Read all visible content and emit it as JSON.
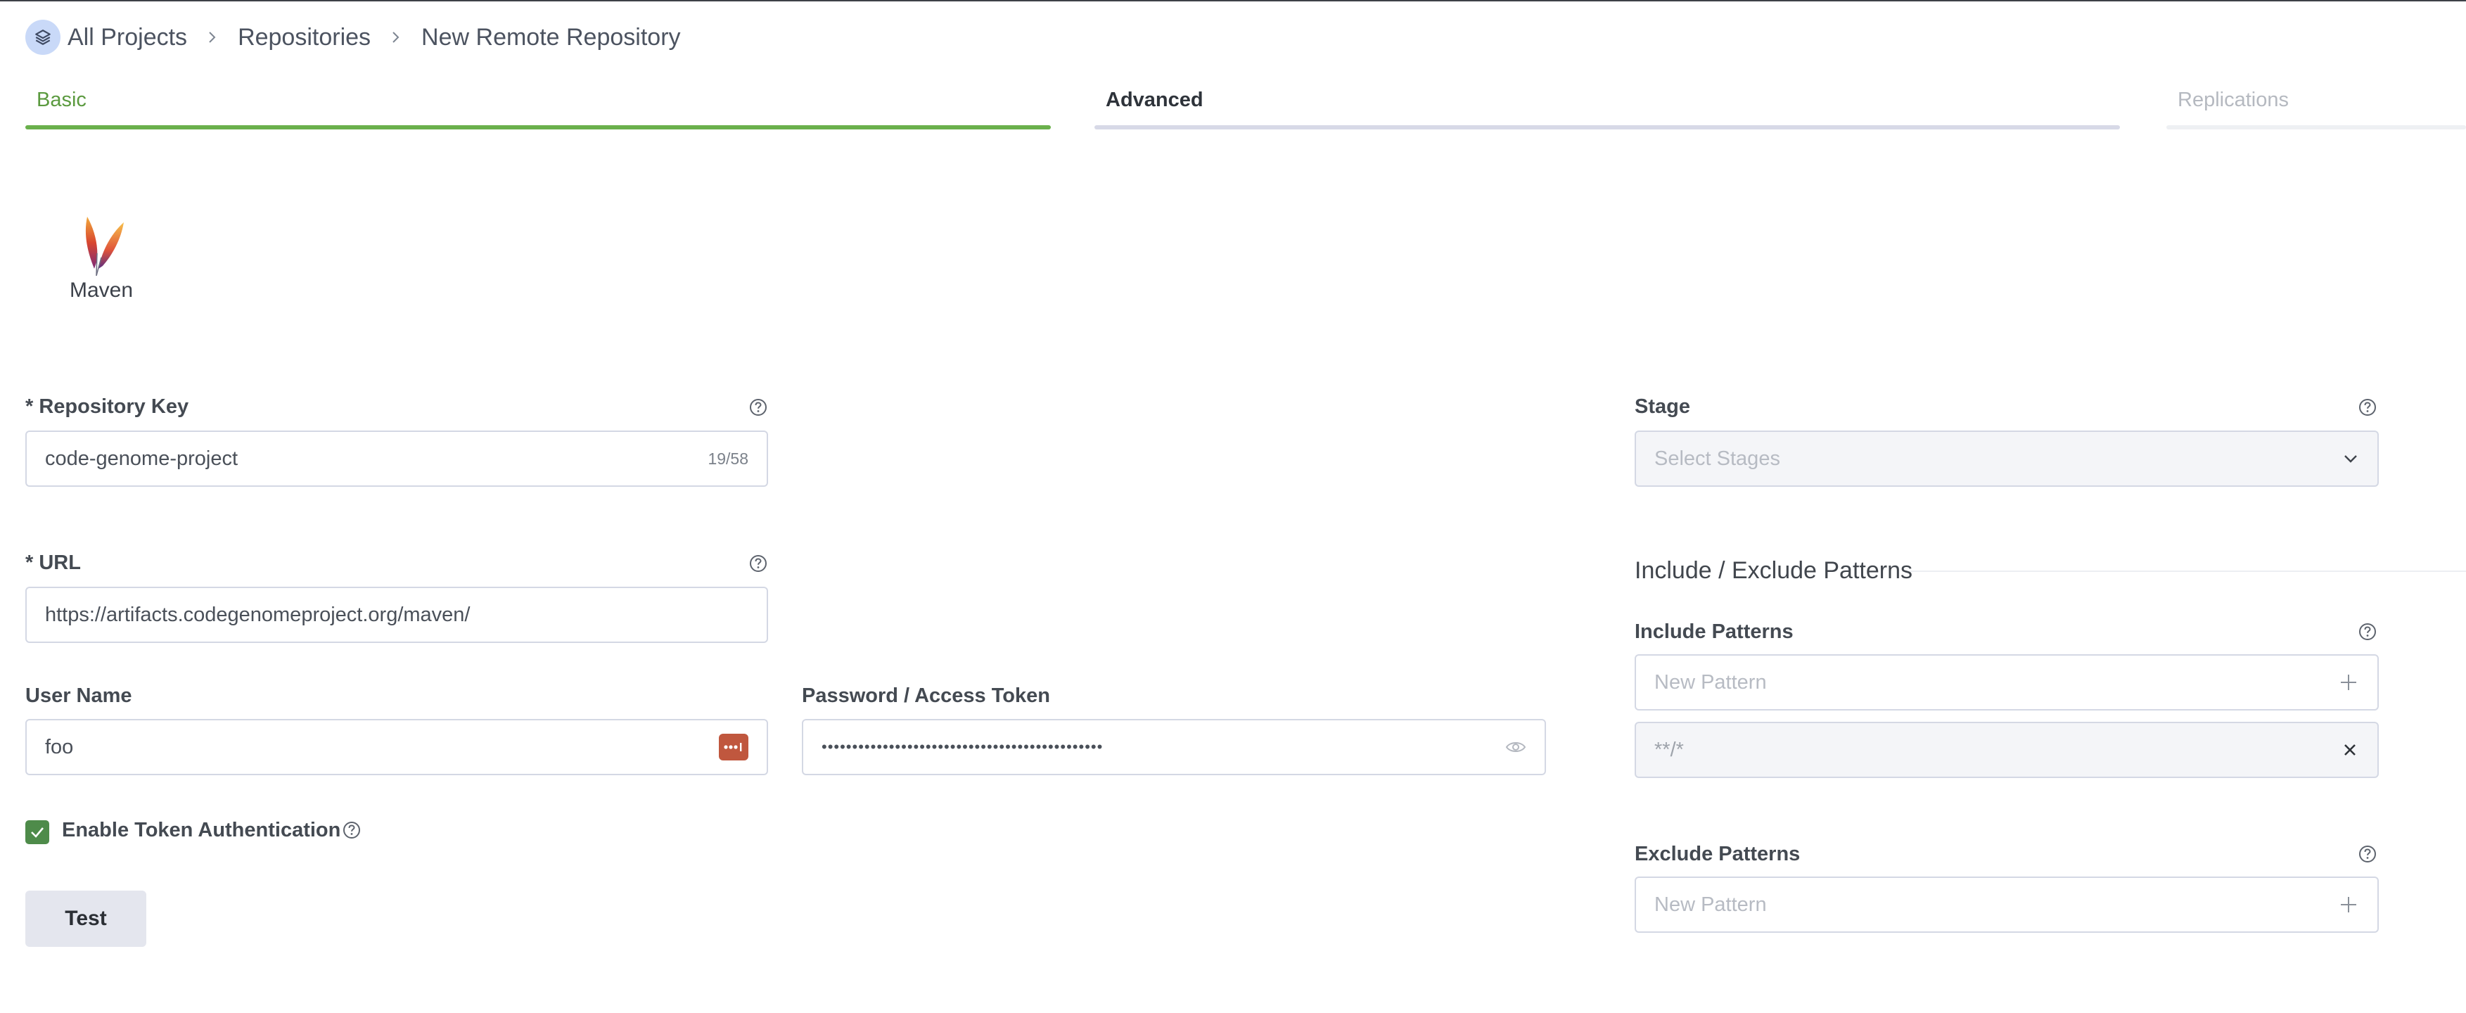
{
  "breadcrumb": {
    "items": [
      "All Projects",
      "Repositories",
      "New Remote Repository"
    ]
  },
  "tabs": [
    {
      "label": "Basic",
      "state": "active"
    },
    {
      "label": "Advanced",
      "state": "normal"
    },
    {
      "label": "Replications",
      "state": "disabled"
    }
  ],
  "package": {
    "label": "Maven",
    "icon": "maven-feather-icon"
  },
  "form": {
    "repo_key": {
      "label": "* Repository Key",
      "value": "code-genome-project",
      "counter": "19/58"
    },
    "url": {
      "label": "* URL",
      "value": "https://artifacts.codegenomeproject.org/maven/"
    },
    "username": {
      "label": "User Name",
      "value": "foo",
      "icon": "key-icon"
    },
    "password": {
      "label": "Password / Access Token",
      "value": "••••••••••••••••••••••••••••••••••••••••••••••",
      "icon": "eye-icon"
    },
    "token_auth": {
      "label": "Enable Token Authentication",
      "checked": true
    },
    "test_button": "Test"
  },
  "right": {
    "stage": {
      "label": "Stage",
      "placeholder": "Select Stages"
    },
    "patterns_title": "Include / Exclude Patterns",
    "include": {
      "label": "Include Patterns",
      "placeholder": "New Pattern",
      "items": [
        "**/*"
      ]
    },
    "exclude": {
      "label": "Exclude Patterns",
      "placeholder": "New Pattern"
    }
  },
  "colors": {
    "accent_green": "#6ab04c",
    "checkbox_green": "#4e8b4a",
    "key_icon": "#c0573e"
  }
}
